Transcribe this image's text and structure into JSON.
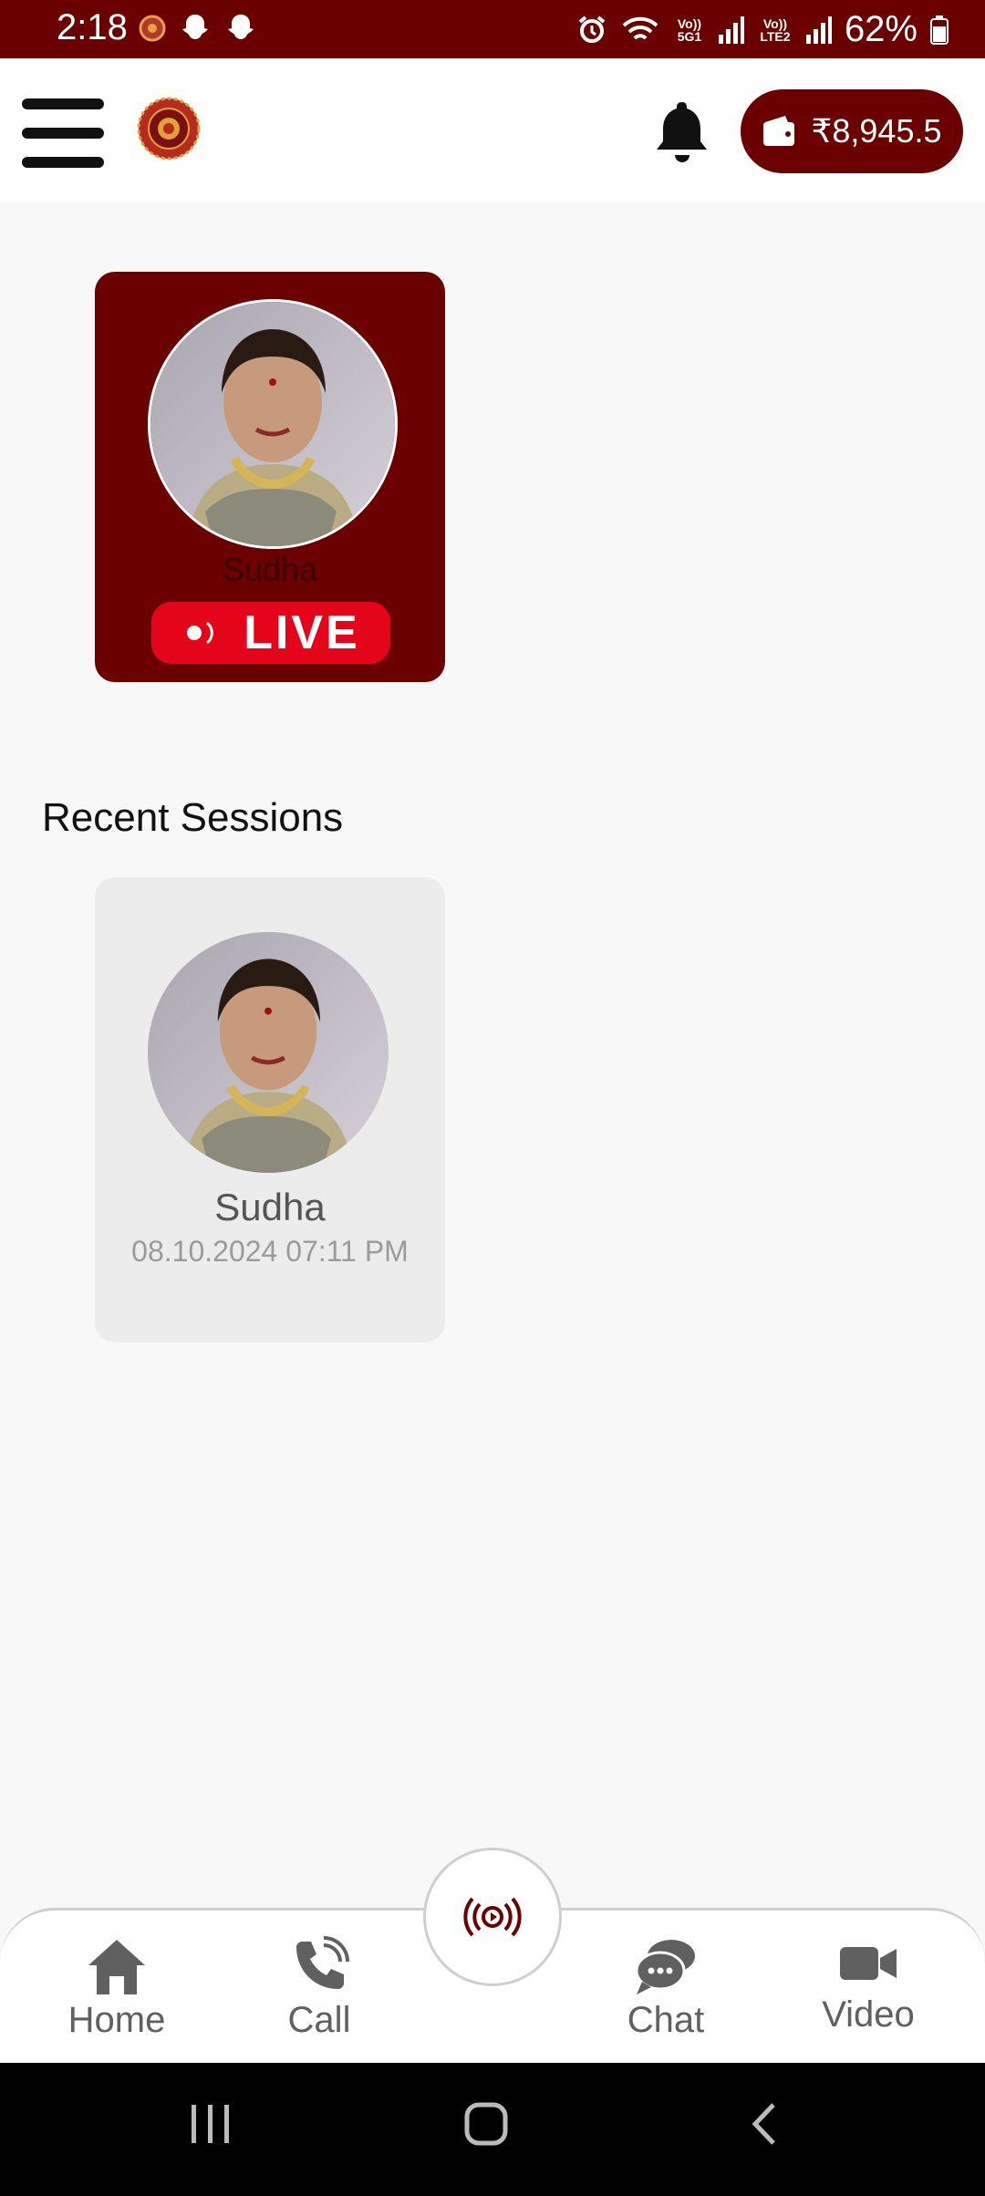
{
  "status_bar": {
    "time": "2:18",
    "battery_percent": "62%",
    "sim1_label": "Vo)) 5G1",
    "sim2_label": "Vo)) LTE2"
  },
  "header": {
    "wallet_amount": "₹8,945.5"
  },
  "live": {
    "host_name": "Sudha",
    "badge_label": "LIVE"
  },
  "recent": {
    "title": "Recent Sessions",
    "sessions": [
      {
        "name": "Sudha",
        "datetime": "08.10.2024 07:11 PM"
      }
    ]
  },
  "bottom_nav": {
    "items": [
      {
        "label": "Home",
        "icon": "home-icon"
      },
      {
        "label": "Call",
        "icon": "phone-icon"
      },
      {
        "label": "Chat",
        "icon": "chat-icon"
      },
      {
        "label": "Video",
        "icon": "video-icon"
      }
    ],
    "center_icon": "live-broadcast-icon"
  },
  "colors": {
    "brand": "#6b0000",
    "live_red": "#e5051b",
    "nav_gray": "#606060"
  }
}
